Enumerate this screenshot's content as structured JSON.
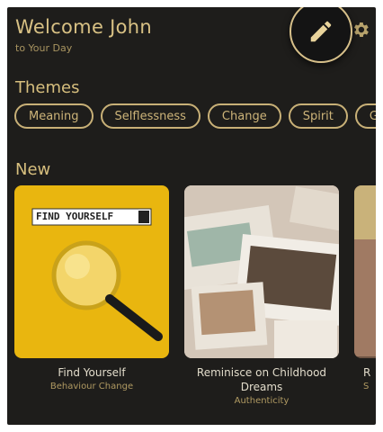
{
  "header": {
    "welcome": "Welcome John",
    "subtitle": "to Your Day"
  },
  "icons": {
    "settings": "gear-icon",
    "edit": "pencil-icon"
  },
  "themes": {
    "heading": "Themes",
    "chips": [
      "Meaning",
      "Selflessness",
      "Change",
      "Spirit",
      "G"
    ]
  },
  "new": {
    "heading": "New",
    "cards": [
      {
        "title": "Find Yourself",
        "tag": "Behaviour Change",
        "image_text": "FIND YOURSELF"
      },
      {
        "title": "Reminisce on Childhood Dreams",
        "tag": "Authenticity"
      },
      {
        "title": "R",
        "tag": "S"
      }
    ]
  },
  "colors": {
    "background": "#1e1d1b",
    "accent": "#d7bf7e",
    "card_yellow": "#e9b60f"
  }
}
